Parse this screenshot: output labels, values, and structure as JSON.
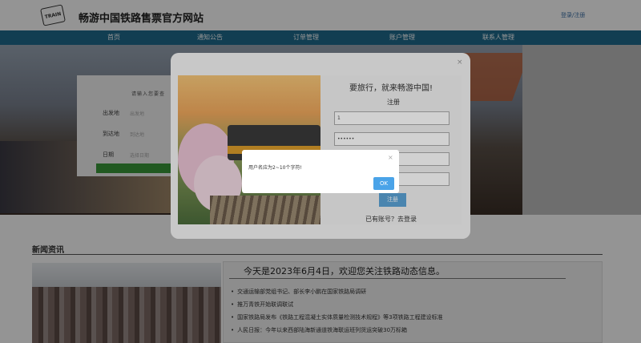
{
  "header": {
    "logo_text": "TRAIN",
    "site_title": "畅游中国铁路售票官方网站",
    "login_register": "登录/注册"
  },
  "nav": {
    "items": [
      "首页",
      "通知公告",
      "订单管理",
      "账户管理",
      "联系人管理"
    ]
  },
  "search": {
    "title": "请输入您要查",
    "from_label": "出发地",
    "from_placeholder": "出发地",
    "to_label": "到达地",
    "to_placeholder": "到达地",
    "date_label": "日期",
    "date_placeholder": "选择日期"
  },
  "news": {
    "title": "新闻资讯",
    "headline": "今天是2023年6月4日，欢迎您关注铁路动态信息。",
    "items": [
      "交通运输部党组书记、部长李小鹏在国家铁路局调研",
      "推万青铁开始联调联试",
      "国家铁路局发布《铁路工程混凝土实体质量检测技术规程》等3项铁路工程建设标准",
      "人民日报：今年以来西部陆海新通道铁海联运班列货运突破30万标箱"
    ]
  },
  "register_modal": {
    "slogan": "要旅行，就来畅游中国!",
    "subtitle": "注册",
    "username_value": "1",
    "password_value": "••••••",
    "submit_label": "注册",
    "switch_text": "已有账号？去登录",
    "close_symbol": "×"
  },
  "alert": {
    "message": "用户名应为2~10个字符!",
    "ok_label": "OK",
    "close_symbol": "×"
  }
}
